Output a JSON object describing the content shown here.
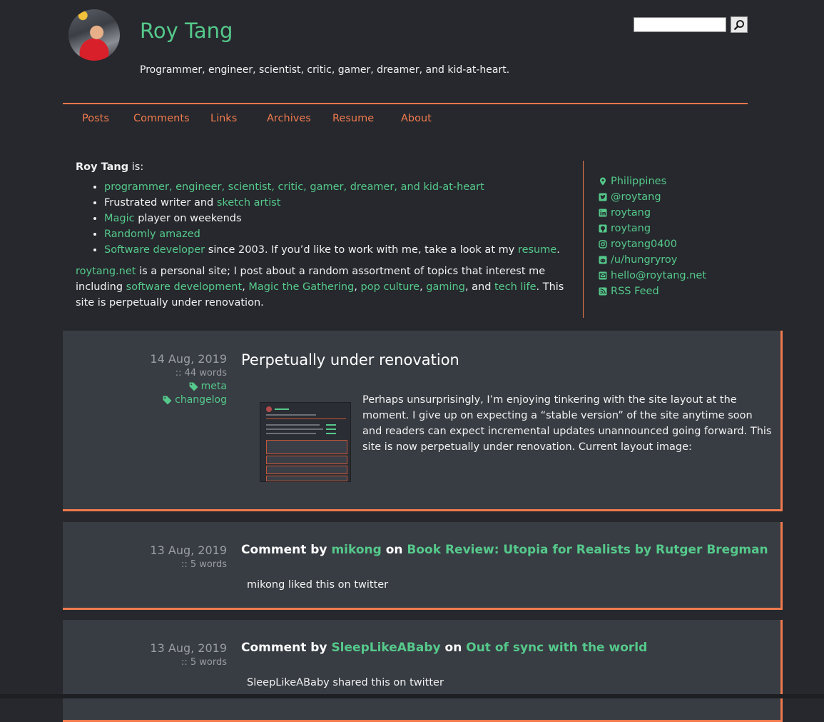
{
  "header": {
    "title": "Roy Tang",
    "tagline": "Programmer, engineer, scientist, critic, gamer, dreamer, and kid-at-heart.",
    "search_placeholder": ""
  },
  "nav": [
    "Posts",
    "Comments",
    "Links",
    "Archives",
    "Resume",
    "About"
  ],
  "intro": {
    "name": "Roy Tang",
    "is_label": " is:",
    "bullets": {
      "b1_link": "programmer, engineer, scientist, critic, gamer, dreamer, and kid-at-heart",
      "b2_pre": "Frustrated writer and ",
      "b2_link": "sketch artist",
      "b3_link": "Magic",
      "b3_post": " player on weekends",
      "b4_link": "Randomly amazed",
      "b5_link": "Software developer",
      "b5_mid": " since 2003. If you’d like to work with me, take a look at my ",
      "b5_link2": "resume",
      "b5_end": "."
    },
    "para": {
      "site_link": "roytang.net",
      "t1": " is a personal site; I post about a random assortment of topics that interest me including ",
      "l1": "software development",
      "c1": ", ",
      "l2": "Magic the Gathering",
      "c2": ", ",
      "l3": "pop culture",
      "c3": ", ",
      "l4": "gaming",
      "c4": ", and ",
      "l5": "tech life",
      "t2": ". This site is perpetually under renovation."
    }
  },
  "social": [
    {
      "icon": "map-marker-icon",
      "label": "Philippines"
    },
    {
      "icon": "twitter-icon",
      "label": "@roytang"
    },
    {
      "icon": "linkedin-icon",
      "label": "roytang"
    },
    {
      "icon": "github-icon",
      "label": "roytang"
    },
    {
      "icon": "instagram-icon",
      "label": "roytang0400"
    },
    {
      "icon": "reddit-icon",
      "label": "/u/hungryroy"
    },
    {
      "icon": "envelope-icon",
      "label": "hello@roytang.net"
    },
    {
      "icon": "rss-icon",
      "label": "RSS Feed"
    }
  ],
  "posts": [
    {
      "date": "14 Aug, 2019",
      "words": ":: 44 words",
      "tags": [
        "meta",
        "changelog"
      ],
      "title": "Perpetually under renovation",
      "body": "Perhaps unsurprisingly, I’m enjoying tinkering with the site layout at the moment. I give up on expecting a “stable version” of the site anytime soon and readers can expect incremental updates unannounced going forward. This site is now perpetually under renovation. Current layout image:"
    },
    {
      "date": "13 Aug, 2019",
      "words": ":: 5 words",
      "prefix": "Comment by ",
      "author": "mikong",
      "on": " on ",
      "target": "Book Review: Utopia for Realists by Rutger Bregman",
      "body": "mikong liked this on twitter"
    },
    {
      "date": "13 Aug, 2019",
      "words": ":: 5 words",
      "prefix": "Comment by ",
      "author": "SleepLikeABaby",
      "on": " on ",
      "target": "Out of sync with the world",
      "body": "SleepLikeABaby shared this on twitter"
    }
  ],
  "colors": {
    "accent": "#f07a4e",
    "link": "#55c98b",
    "background": "#26282d",
    "card": "#383c43"
  }
}
